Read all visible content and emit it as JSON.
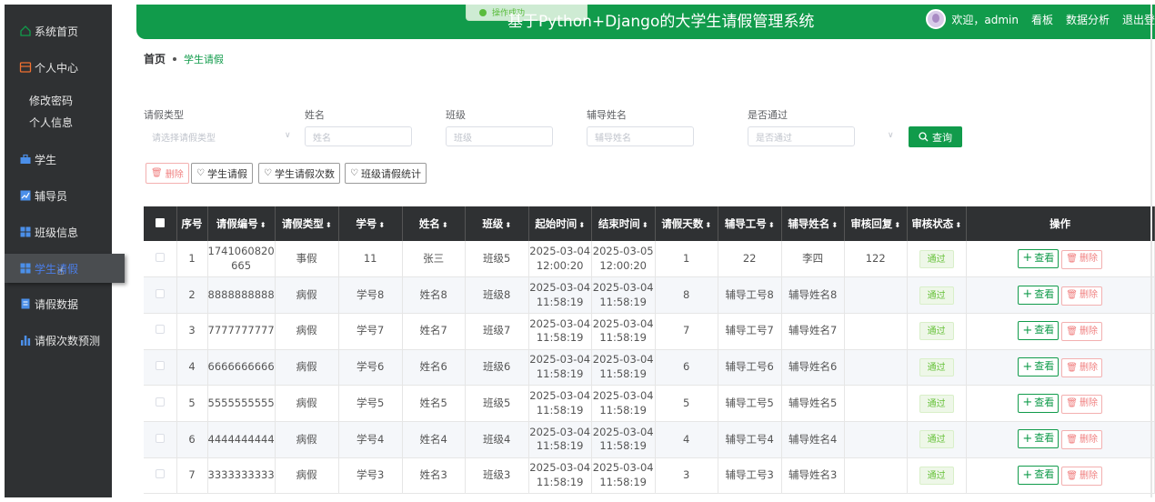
{
  "sidebar": {
    "items": [
      {
        "label": "系统首页",
        "icon": "home-icon"
      },
      {
        "label": "个人中心",
        "icon": "user-center-icon"
      },
      {
        "label": "学生",
        "icon": "briefcase-icon"
      },
      {
        "label": "辅导员",
        "icon": "chart-icon"
      },
      {
        "label": "班级信息",
        "icon": "grid-icon"
      },
      {
        "label": "学生请假",
        "icon": "grid-icon"
      },
      {
        "label": "请假数据",
        "icon": "document-icon"
      },
      {
        "label": "请假次数预测",
        "icon": "bar-chart-icon"
      }
    ],
    "subitems": [
      "修改密码",
      "个人信息"
    ]
  },
  "header": {
    "title": "基于Python+Django的大学生请假管理系统",
    "toast": "操作成功",
    "welcome": "欢迎，admin",
    "links": [
      "看板",
      "数据分析",
      "退出登"
    ]
  },
  "breadcrumb": {
    "home": "首页",
    "current": "学生请假"
  },
  "search": {
    "fields": [
      {
        "label": "请假类型",
        "placeholder": "请选择请假类型"
      },
      {
        "label": "姓名",
        "placeholder": "姓名"
      },
      {
        "label": "班级",
        "placeholder": "班级"
      },
      {
        "label": "辅导姓名",
        "placeholder": "辅导姓名"
      },
      {
        "label": "是否通过",
        "placeholder": "是否通过"
      }
    ],
    "button": "查询"
  },
  "toolbar": {
    "delete": "删除",
    "btn1": "学生请假",
    "btn2": "学生请假次数",
    "btn3": "班级请假统计"
  },
  "table": {
    "headers": [
      "序号",
      "请假编号",
      "请假类型",
      "学号",
      "姓名",
      "班级",
      "起始时间",
      "结束时间",
      "请假天数",
      "辅导工号",
      "辅导姓名",
      "审核回复",
      "审核状态",
      "操作"
    ],
    "view_label": "查看",
    "delete_label": "删除",
    "rows": [
      {
        "idx": "1",
        "code1": "1741060820",
        "code2": "665",
        "type": "事假",
        "sno": "11",
        "name": "张三",
        "cls": "班级5",
        "s1": "2025-03-04",
        "s2": "12:00:20",
        "e1": "2025-03-05",
        "e2": "12:00:20",
        "days": "1",
        "tno": "22",
        "tname": "李四",
        "reply": "122",
        "status": "通过"
      },
      {
        "idx": "2",
        "code1": "8888888888",
        "code2": "",
        "type": "病假",
        "sno": "学号8",
        "name": "姓名8",
        "cls": "班级8",
        "s1": "2025-03-04",
        "s2": "11:58:19",
        "e1": "2025-03-04",
        "e2": "11:58:19",
        "days": "8",
        "tno": "辅导工号8",
        "tname": "辅导姓名8",
        "reply": "",
        "status": "通过"
      },
      {
        "idx": "3",
        "code1": "7777777777",
        "code2": "",
        "type": "病假",
        "sno": "学号7",
        "name": "姓名7",
        "cls": "班级7",
        "s1": "2025-03-04",
        "s2": "11:58:19",
        "e1": "2025-03-04",
        "e2": "11:58:19",
        "days": "7",
        "tno": "辅导工号7",
        "tname": "辅导姓名7",
        "reply": "",
        "status": "通过"
      },
      {
        "idx": "4",
        "code1": "6666666666",
        "code2": "",
        "type": "病假",
        "sno": "学号6",
        "name": "姓名6",
        "cls": "班级6",
        "s1": "2025-03-04",
        "s2": "11:58:19",
        "e1": "2025-03-04",
        "e2": "11:58:19",
        "days": "6",
        "tno": "辅导工号6",
        "tname": "辅导姓名6",
        "reply": "",
        "status": "通过"
      },
      {
        "idx": "5",
        "code1": "5555555555",
        "code2": "",
        "type": "病假",
        "sno": "学号5",
        "name": "姓名5",
        "cls": "班级5",
        "s1": "2025-03-04",
        "s2": "11:58:19",
        "e1": "2025-03-04",
        "e2": "11:58:19",
        "days": "5",
        "tno": "辅导工号5",
        "tname": "辅导姓名5",
        "reply": "",
        "status": "通过"
      },
      {
        "idx": "6",
        "code1": "4444444444",
        "code2": "",
        "type": "病假",
        "sno": "学号4",
        "name": "姓名4",
        "cls": "班级4",
        "s1": "2025-03-04",
        "s2": "11:58:19",
        "e1": "2025-03-04",
        "e2": "11:58:19",
        "days": "4",
        "tno": "辅导工号4",
        "tname": "辅导姓名4",
        "reply": "",
        "status": "通过"
      },
      {
        "idx": "7",
        "code1": "3333333333",
        "code2": "",
        "type": "病假",
        "sno": "学号3",
        "name": "姓名3",
        "cls": "班级3",
        "s1": "2025-03-04",
        "s2": "11:58:19",
        "e1": "2025-03-04",
        "e2": "11:58:19",
        "days": "3",
        "tno": "辅导工号3",
        "tname": "辅导姓名3",
        "reply": "",
        "status": "通过"
      }
    ]
  },
  "colors": {
    "accent": "#119b4b",
    "sidebar": "#2f3133",
    "danger": "#f08080",
    "success": "#67c23a"
  }
}
